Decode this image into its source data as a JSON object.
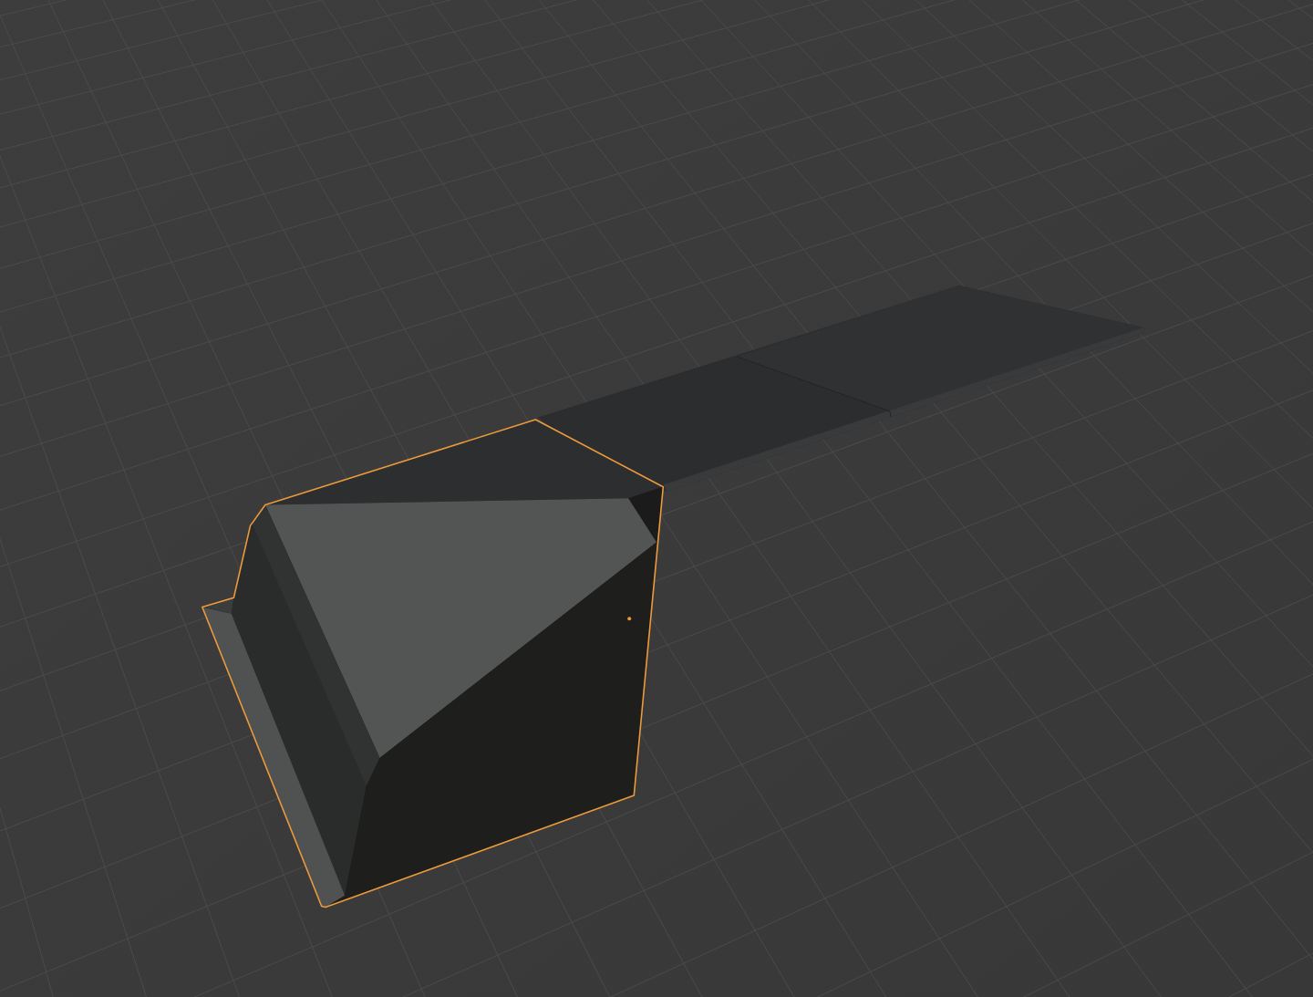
{
  "viewport": {
    "objects": [
      {
        "kind": "slab",
        "selected": false
      },
      {
        "kind": "block",
        "selected": true
      }
    ]
  }
}
